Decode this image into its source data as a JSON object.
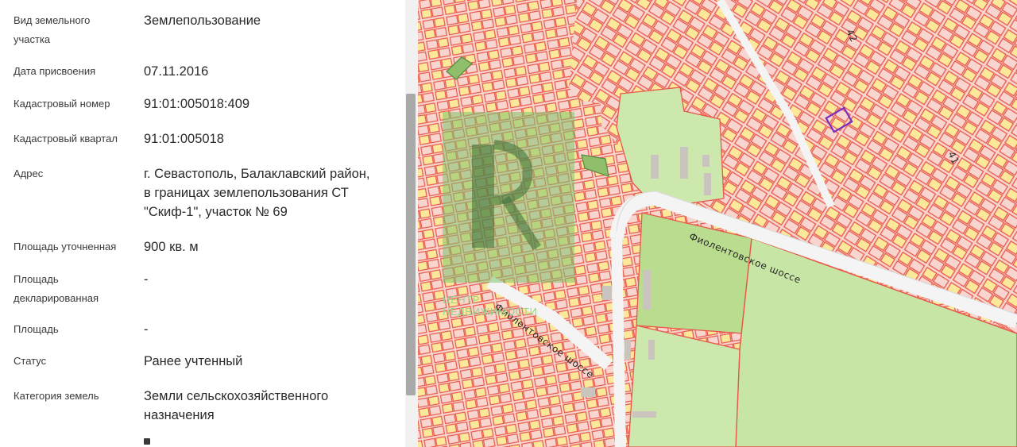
{
  "properties": [
    {
      "label": "Вид земельного\nучастка",
      "value": "Землепользование"
    },
    {
      "label": "Дата присвоения",
      "value": "07.11.2016"
    },
    {
      "label": "Кадастровый номер",
      "value": "91:01:005018:409"
    },
    {
      "label": "Кадастровый квартал",
      "value": "91:01:005018"
    },
    {
      "label": "Адрес",
      "value": "г. Севастополь, Балаклавский район,\nв границах землепользования СТ\n\"Скиф-1\", участок № 69"
    },
    {
      "label": "Площадь уточненная",
      "value": "900 кв. м"
    },
    {
      "label": "Площадь\nдекларированная",
      "value": "-"
    },
    {
      "label": "Площадь",
      "value": "-"
    },
    {
      "label": "Статус",
      "value": "Ранее учтенный"
    },
    {
      "label": "Категория земель",
      "value": "Земли сельскохозяйственного\nназначения"
    }
  ],
  "map": {
    "street_label_1": "Фиолентовское шоссе",
    "street_label_2": "Фиолентовское шоссе",
    "block_number_1": "42",
    "block_number_2": "41",
    "watermark_text": "ЦЕНТР\nНЕДВИЖИМОСТИ",
    "colors": {
      "parcel_fill": "#f8d6cf",
      "parcel_border": "#e8574a",
      "residential_fill": "#fbe89a",
      "green_fill": "#b9dc8e",
      "light_green_fill": "#cde8ad",
      "road": "#f2f2f2",
      "selected_parcel": "#7b2fbf",
      "watermark": "#7fc46b"
    }
  }
}
